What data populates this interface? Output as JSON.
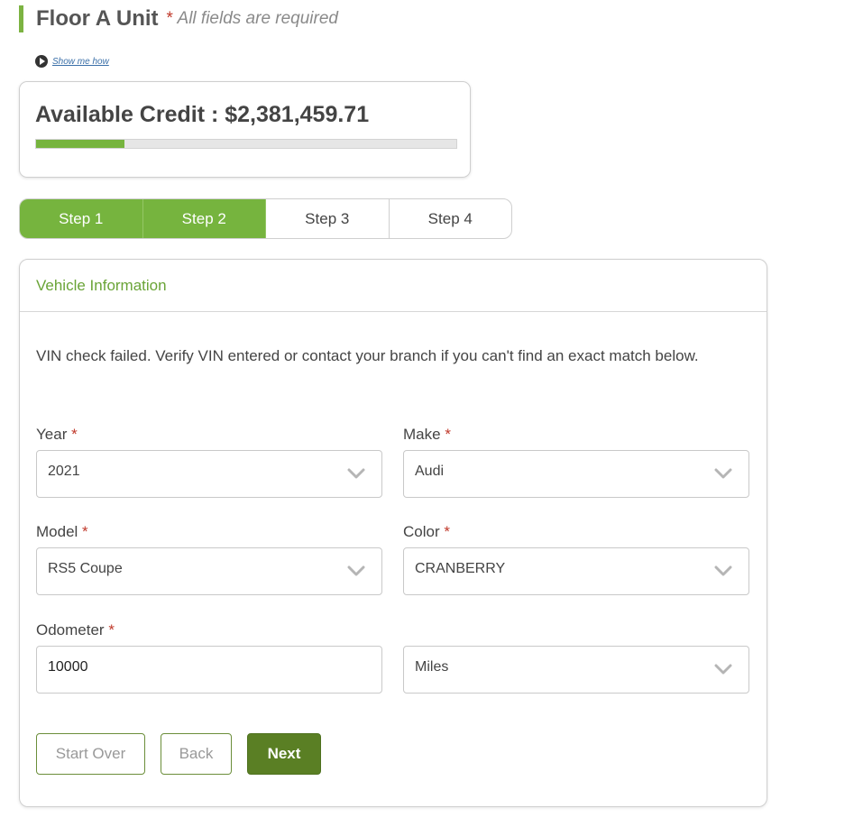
{
  "header": {
    "title": "Floor A Unit",
    "required_star": "*",
    "required_note": "All fields are required"
  },
  "help_link": {
    "label": "Show me how",
    "icon": "play-circle-icon"
  },
  "credit": {
    "label": "Available Credit : $2,381,459.71",
    "usage_fraction": 0.21,
    "accent_color": "#76b43e"
  },
  "steps": [
    {
      "label": "Step 1",
      "completed": true
    },
    {
      "label": "Step 2",
      "completed": true
    },
    {
      "label": "Step 3",
      "completed": false
    },
    {
      "label": "Step 4",
      "completed": false
    }
  ],
  "panel": {
    "title": "Vehicle Information",
    "notice": "VIN check failed. Verify VIN entered or contact your branch if you can't find an exact match below."
  },
  "fields": {
    "year": {
      "label": "Year",
      "star": "*",
      "value": "2021",
      "icon": "chevron-down-icon"
    },
    "make": {
      "label": "Make",
      "star": "*",
      "value": "Audi",
      "icon": "chevron-down-icon"
    },
    "model": {
      "label": "Model",
      "star": "*",
      "value": "RS5 Coupe",
      "icon": "chevron-down-icon"
    },
    "color": {
      "label": "Color",
      "star": "*",
      "value": "CRANBERRY",
      "icon": "chevron-down-icon"
    },
    "odometer": {
      "label": "Odometer",
      "star": "*",
      "value": "10000"
    },
    "unit": {
      "value": "Miles",
      "icon": "chevron-down-icon"
    }
  },
  "buttons": {
    "start_over": "Start Over",
    "back": "Back",
    "next": "Next"
  },
  "colors": {
    "accent_green": "#76b43e",
    "primary_button": "#5a7f24",
    "required_red": "#c0392b"
  }
}
